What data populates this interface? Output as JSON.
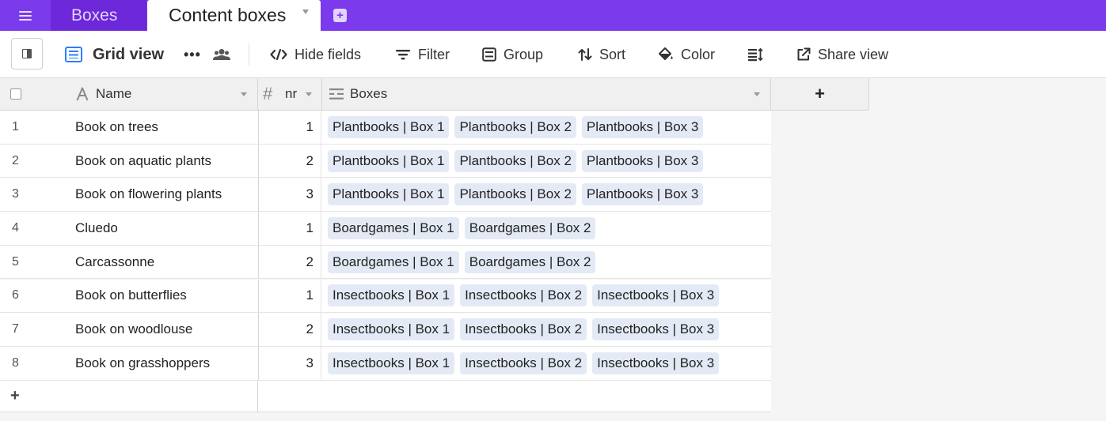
{
  "app": {
    "base_name": "Boxes",
    "table_name": "Content boxes",
    "add_table_symbol": "+"
  },
  "toolbar": {
    "view_name": "Grid view",
    "more_symbol": "•••",
    "hide_fields": "Hide fields",
    "filter": "Filter",
    "group": "Group",
    "sort": "Sort",
    "color": "Color",
    "share_view": "Share view"
  },
  "columns": {
    "name": "Name",
    "nr": "nr",
    "boxes": "Boxes",
    "add_symbol": "+"
  },
  "rows": [
    {
      "num": "1",
      "name": "Book on trees",
      "nr": "1",
      "boxes": [
        "Plantbooks | Box 1",
        "Plantbooks | Box 2",
        "Plantbooks | Box 3"
      ]
    },
    {
      "num": "2",
      "name": "Book on aquatic plants",
      "nr": "2",
      "boxes": [
        "Plantbooks | Box 1",
        "Plantbooks | Box 2",
        "Plantbooks | Box 3"
      ]
    },
    {
      "num": "3",
      "name": "Book on flowering plants",
      "nr": "3",
      "boxes": [
        "Plantbooks | Box 1",
        "Plantbooks | Box 2",
        "Plantbooks | Box 3"
      ]
    },
    {
      "num": "4",
      "name": "Cluedo",
      "nr": "1",
      "boxes": [
        "Boardgames | Box 1",
        "Boardgames | Box 2"
      ]
    },
    {
      "num": "5",
      "name": "Carcassonne",
      "nr": "2",
      "boxes": [
        "Boardgames | Box 1",
        "Boardgames | Box 2"
      ]
    },
    {
      "num": "6",
      "name": "Book on butterflies",
      "nr": "1",
      "boxes": [
        "Insectbooks | Box 1",
        "Insectbooks | Box 2",
        "Insectbooks | Box 3"
      ]
    },
    {
      "num": "7",
      "name": "Book on woodlouse",
      "nr": "2",
      "boxes": [
        "Insectbooks | Box 1",
        "Insectbooks | Box 2",
        "Insectbooks | Box 3"
      ]
    },
    {
      "num": "8",
      "name": "Book on grasshoppers",
      "nr": "3",
      "boxes": [
        "Insectbooks | Box 1",
        "Insectbooks | Box 2",
        "Insectbooks | Box 3"
      ]
    }
  ],
  "add_row_symbol": "+",
  "colors": {
    "topbar": "#7c3aed",
    "accent_blue": "#2d7ff9",
    "chip_background": "#e4eaf5"
  },
  "icons": {
    "menu": "hamburger-icon",
    "grid_view": "grid-icon",
    "collaborators": "people-icon",
    "hide_fields": "code-icon",
    "filter": "filter-icon",
    "group": "group-icon",
    "sort": "sort-icon",
    "color": "paint-bucket-icon",
    "row_height": "row-height-icon",
    "share": "share-icon"
  }
}
